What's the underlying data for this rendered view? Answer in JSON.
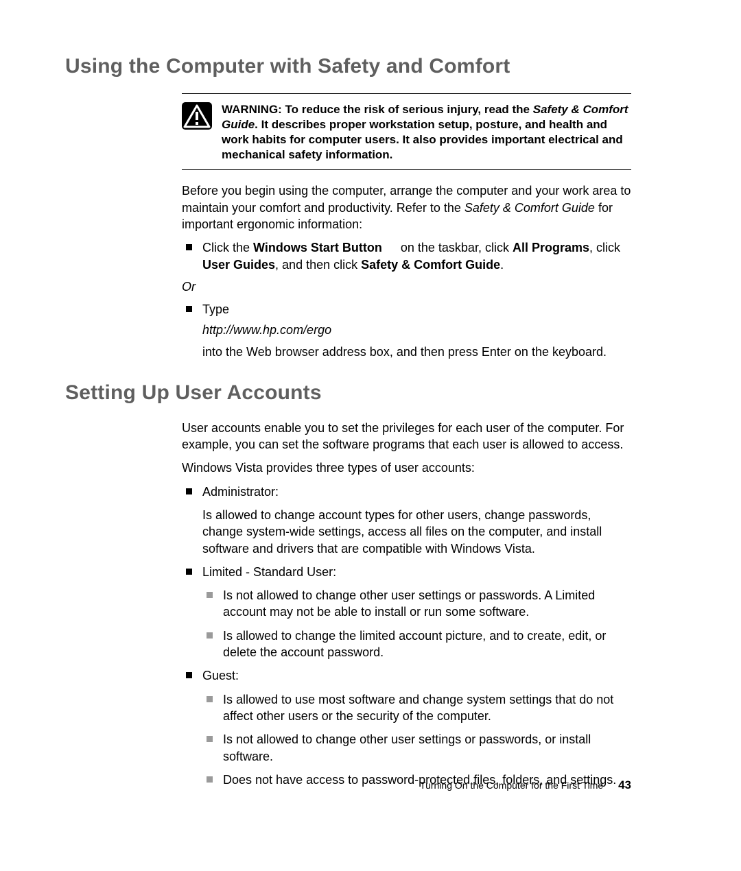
{
  "section1": {
    "heading": "Using the Computer with Safety and Comfort",
    "warning": {
      "prefix": "WARNING: To reduce the risk of serious injury, read the ",
      "guide_name": "Safety & Comfort Guide",
      "suffix": ". It describes proper workstation setup, posture, and health and work habits for computer users. It also provides important electrical and mechanical safety information."
    },
    "intro_pre": "Before you begin using the computer, arrange the computer and your work area to maintain your comfort and productivity. Refer to the ",
    "intro_guide": "Safety & Comfort Guide",
    "intro_post": " for important ergonomic information:",
    "bullet1": {
      "t1": "Click the ",
      "b1": "Windows Start Button",
      "t2": " on the taskbar, click ",
      "b2": "All Programs",
      "t3": ", click ",
      "b3": "User Guides",
      "t4": ", and then click ",
      "b4": "Safety & Comfort Guide",
      "t5": "."
    },
    "or": "Or",
    "bullet2": {
      "type_label": "Type",
      "url": "http://www.hp.com/ergo",
      "after": "into the Web browser address box, and then press Enter on the keyboard."
    }
  },
  "section2": {
    "heading": "Setting Up User Accounts",
    "p1": "User accounts enable you to set the privileges for each user of the computer. For example, you can set the software programs that each user is allowed to access.",
    "p2": "Windows Vista provides three types of user accounts:",
    "admin": {
      "title": "Administrator:",
      "desc": "Is allowed to change account types for other users, change passwords, change system-wide settings, access all files on the computer, and install software and drivers that are compatible with Windows Vista."
    },
    "limited": {
      "title": "Limited - Standard User:",
      "s1": "Is not allowed to change other user settings or passwords. A Limited account may not be able to install or run some software.",
      "s2": "Is allowed to change the limited account picture, and to create, edit, or delete the account password."
    },
    "guest": {
      "title": "Guest:",
      "s1": "Is allowed to use most software and change system settings that do not affect other users or the security of the computer.",
      "s2": "Is not allowed to change other user settings or passwords, or install software.",
      "s3": "Does not have access to password-protected files, folders, and settings."
    }
  },
  "footer": {
    "text": "Turning On the Computer for the First Time",
    "page": "43"
  }
}
